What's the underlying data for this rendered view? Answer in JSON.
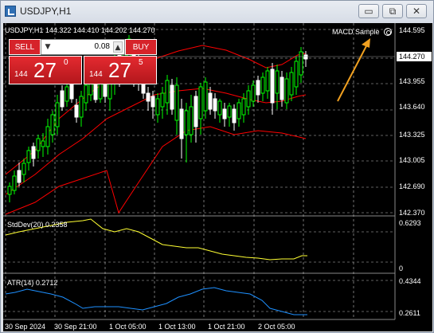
{
  "window": {
    "title": "USDJPY,H1",
    "minimize_glyph": "▭",
    "restore_glyph": "⧉",
    "close_glyph": "✕"
  },
  "chart": {
    "top_label": "USDJPY,H1  144.322 144.410 144.202 144.270",
    "expert_label": "MACD Sample",
    "current_price": "144.270",
    "price_axis": [
      "144.595",
      "143.955",
      "143.640",
      "143.325",
      "143.005",
      "142.690",
      "142.370"
    ],
    "stddev_label": "StdDev(20) 0.2358",
    "stddev_axis": [
      "0.6293",
      "0"
    ],
    "atr_label": "ATR(14) 0.2712",
    "atr_axis": [
      "0.4344",
      "0.2611"
    ],
    "time_axis": [
      "30 Sep 2024",
      "30 Sep 21:00",
      "1 Oct 05:00",
      "1 Oct 13:00",
      "1 Oct 21:00",
      "2 Oct 05:00"
    ],
    "colors": {
      "bull": "#00ff00",
      "bear": "#ffffff",
      "bands": "#ff0000",
      "stddev": "#ffff33",
      "atr": "#1e90ff",
      "arrow": "#f0a020",
      "grid": "#c0c0c0"
    }
  },
  "trade_panel": {
    "sell_label": "SELL",
    "buy_label": "BUY",
    "lot_value": "0.08",
    "lot_down": "▼",
    "lot_up": "▲",
    "sell_price_prefix": "144",
    "sell_price_big": "27",
    "sell_price_sup": "0",
    "buy_price_prefix": "144",
    "buy_price_big": "27",
    "buy_price_sup": "5"
  }
}
